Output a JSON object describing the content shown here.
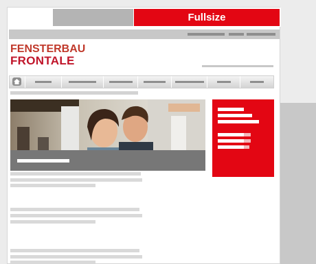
{
  "tabs": {
    "fullsize_label": "Fullsize"
  },
  "logo": {
    "line1": "FENSTERBAU",
    "line2": "FRONTALE"
  },
  "colors": {
    "accent": "#e30613",
    "placeholder_gray": "#b4b4b4"
  }
}
